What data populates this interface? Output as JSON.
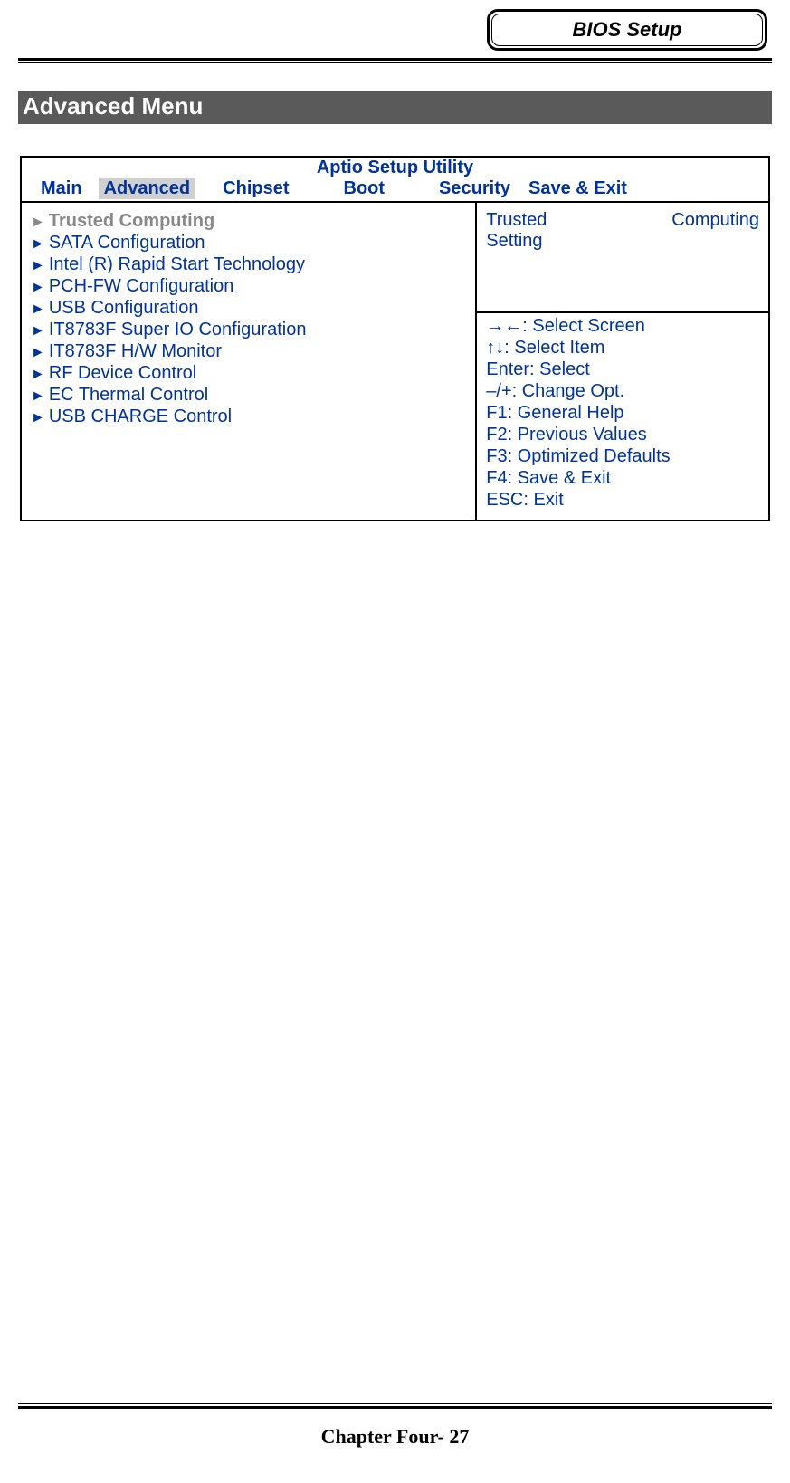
{
  "header": {
    "box_title": "BIOS Setup"
  },
  "section_title": "Advanced Menu",
  "bios": {
    "utility_title": "Aptio Setup Utility",
    "tabs": {
      "main": "Main",
      "advanced": "Advanced",
      "chipset": "Chipset",
      "boot": "Boot",
      "security": "Security",
      "save_exit": "Save & Exit"
    },
    "menu_items": [
      {
        "label": "Trusted Computing",
        "selected": true
      },
      {
        "label": "SATA Configuration",
        "selected": false
      },
      {
        "label": "Intel (R) Rapid Start Technology",
        "selected": false
      },
      {
        "label": "PCH-FW Configuration",
        "selected": false
      },
      {
        "label": "USB Configuration",
        "selected": false
      },
      {
        "label": "IT8783F Super IO Configuration",
        "selected": false
      },
      {
        "label": "IT8783F H/W Monitor",
        "selected": false
      },
      {
        "label": "RF Device Control",
        "selected": false
      },
      {
        "label": "EC Thermal Control",
        "selected": false
      },
      {
        "label": "USB CHARGE Control",
        "selected": false
      }
    ],
    "help": {
      "word1": "Trusted",
      "word2": "Computing",
      "line2": "Setting"
    },
    "key_hints": [
      "→←: Select Screen",
      "↑↓: Select Item",
      "Enter: Select",
      "–/+: Change Opt.",
      "F1: General Help",
      "F2: Previous Values",
      "F3: Optimized Defaults",
      "F4: Save & Exit",
      "ESC: Exit"
    ]
  },
  "footer": {
    "text": "Chapter Four- 27"
  }
}
